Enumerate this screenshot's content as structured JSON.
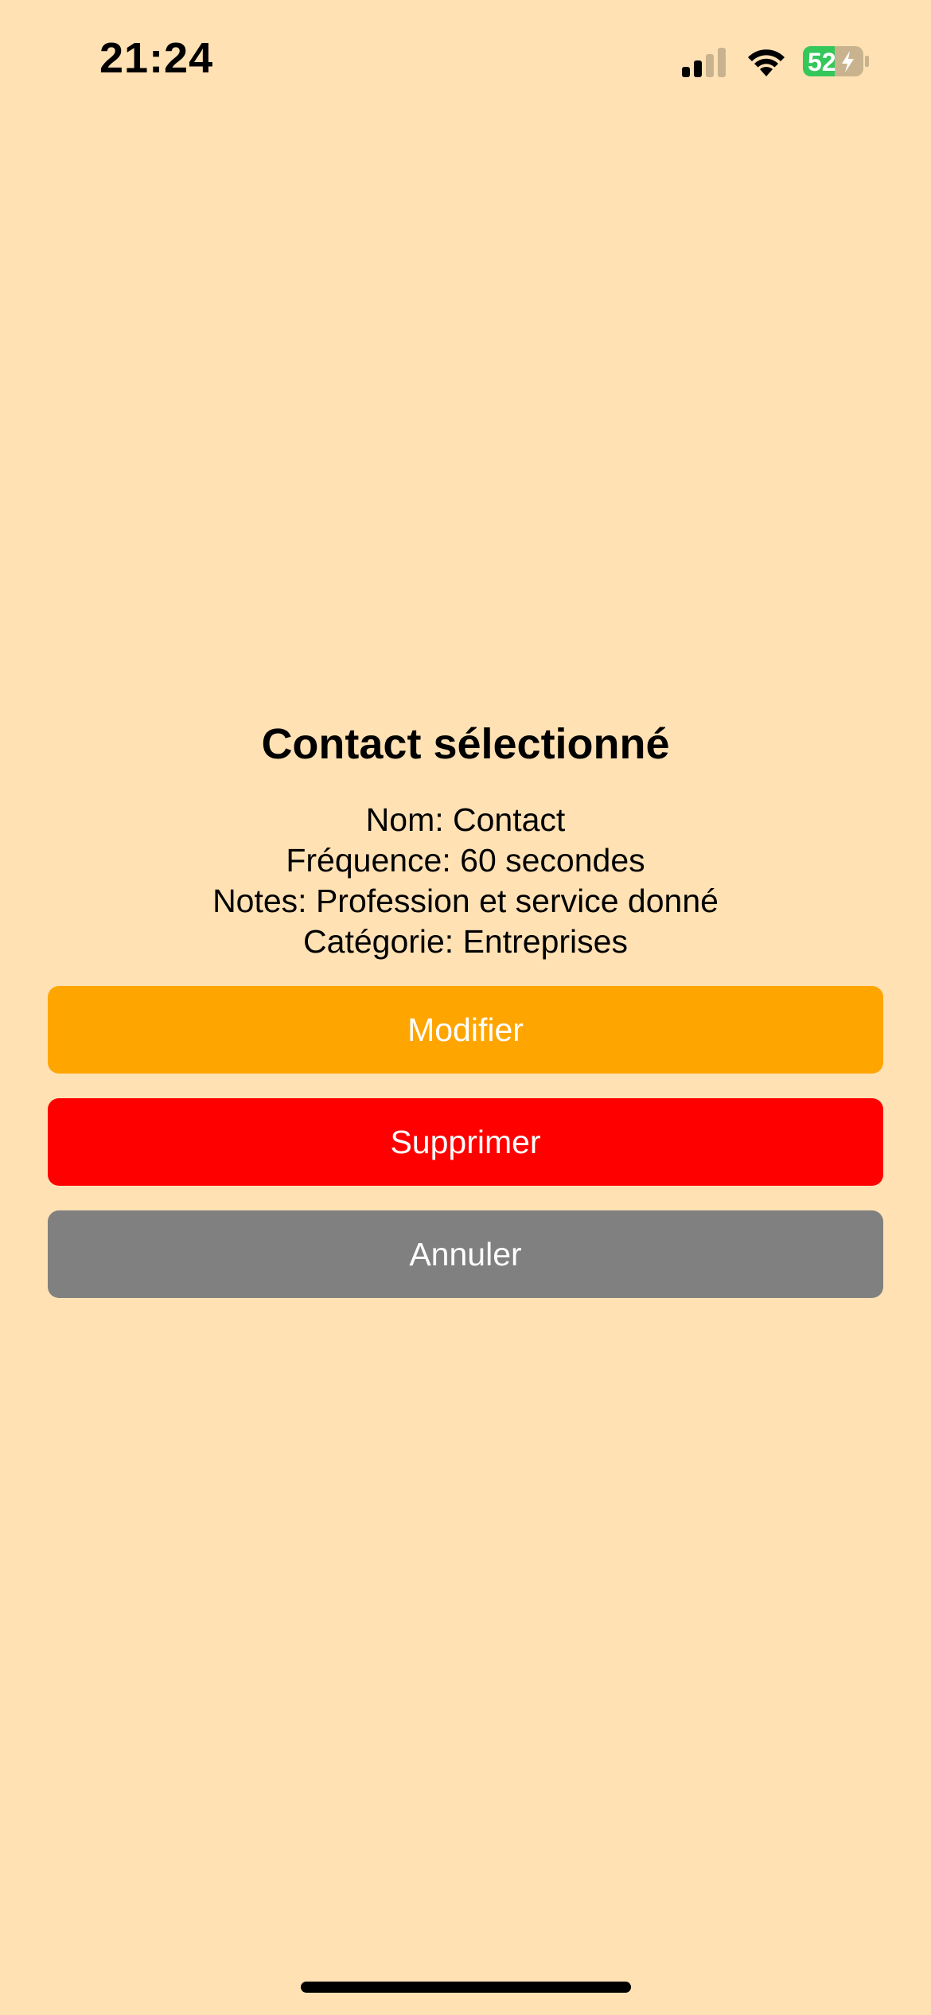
{
  "status_bar": {
    "time": "21:24",
    "battery_level": "52",
    "icons": [
      "signal-icon",
      "wifi-icon",
      "battery-charging-icon"
    ],
    "signal_bars_active": 2,
    "signal_bars_total": 4
  },
  "dialog": {
    "title": "Contact sélectionné",
    "name_line": "Nom: Contact",
    "frequency_line": "Fréquence: 60 secondes",
    "notes_line": "Notes: Profession et service donné",
    "category_line": "Catégorie: Entreprises"
  },
  "buttons": {
    "modify_label": "Modifier",
    "delete_label": "Supprimer",
    "cancel_label": "Annuler"
  },
  "colors": {
    "background": "#FFE1B4",
    "modify": "#FFA500",
    "delete": "#FF0000",
    "cancel": "#808080",
    "battery_green": "#34C759"
  }
}
